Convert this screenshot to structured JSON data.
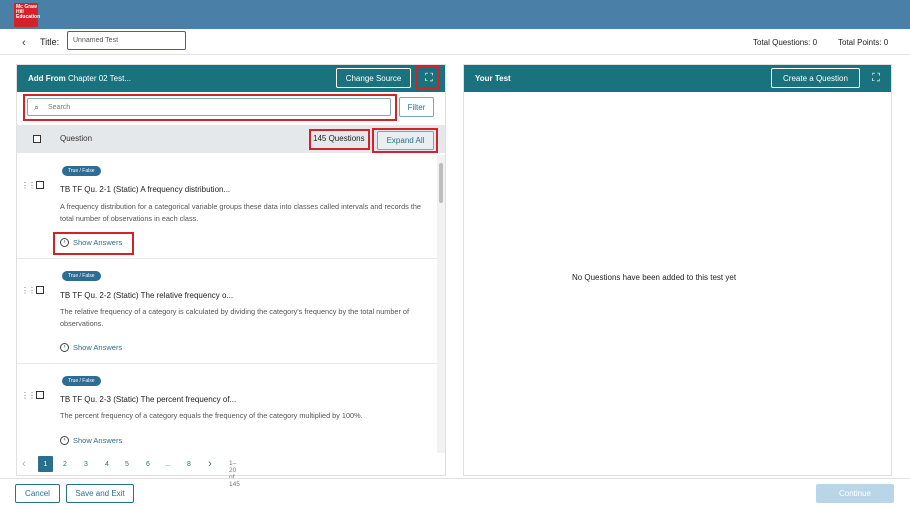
{
  "brand": {
    "logo_text": "Mc Graw Hill Education",
    "color": "#d2232a"
  },
  "header": {
    "back_icon": "chevron-left-icon",
    "title_label": "Title:",
    "title_value": "Unnamed Test",
    "total_questions": "Total Questions: 0",
    "total_points": "Total Points: 0"
  },
  "left_panel": {
    "title_prefix": "Add From",
    "title_source": "Chapter 02 Test...",
    "change_source": "Change Source",
    "search_placeholder": "Search",
    "filter": "Filter",
    "list_header": "Question",
    "question_count": "145 Questions",
    "expand_all": "Expand All",
    "questions": [
      {
        "type": "True / False",
        "title": "TB TF Qu. 2-1 (Static) A frequency distribution...",
        "text": "A frequency distribution for a categorical variable groups these data into classes called intervals and records the total number of observations in each class.",
        "show_answers": "Show Answers"
      },
      {
        "type": "True / False",
        "title": "TB TF Qu. 2-2 (Static) The relative frequency o...",
        "text": "The relative frequency of a category is calculated by dividing the category's frequency by the total number of observations.",
        "show_answers": "Show Answers"
      },
      {
        "type": "True / False",
        "title": "TB TF Qu. 2-3 (Static) The percent frequency of...",
        "text": "The percent frequency of a category equals the frequency of the category multiplied by 100%.",
        "show_answers": "Show Answers"
      }
    ],
    "pagination": {
      "prev": "‹",
      "pages": [
        "1",
        "2",
        "3",
        "4",
        "5",
        "6",
        "...",
        "8"
      ],
      "next": "›",
      "info": "1–20 of 145"
    }
  },
  "right_panel": {
    "title": "Your Test",
    "create_question": "Create a Question",
    "empty_message": "No Questions have been added to this test yet"
  },
  "footer": {
    "cancel": "Cancel",
    "save_exit": "Save and Exit",
    "continue": "Continue"
  },
  "colors": {
    "topbar": "#4a7fa8",
    "panel_header": "#19727e",
    "accent": "#2b6f8e",
    "highlight": "#d2232a"
  }
}
